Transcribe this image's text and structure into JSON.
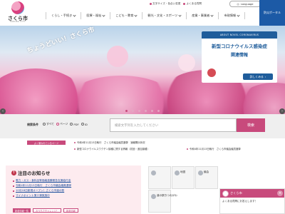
{
  "logo": {
    "text": "さくら市",
    "sub": "SAKURA CITY"
  },
  "util": {
    "links": [
      {
        "label": "文字サイズ・色合い変更"
      },
      {
        "label": "よくある質問"
      }
    ],
    "language": "Language",
    "disaster_portal": "防災ポータル"
  },
  "gnav": [
    {
      "label": "くらし・手続き"
    },
    {
      "label": "医療・福祉"
    },
    {
      "label": "こども・教育"
    },
    {
      "label": "観光・文化・スポーツ"
    },
    {
      "label": "産業・事業者"
    },
    {
      "label": "市政情報"
    }
  ],
  "hero": {
    "catch": "ちょうどいい！さくら市",
    "covid": {
      "top": "ABOUT NOVEL CORONAVIRUS",
      "title": "新型コロナウイルス感染症",
      "sub": "関連情報",
      "more": "詳しくみる"
    }
  },
  "slider": {
    "dots": 6,
    "active_index": 0
  },
  "search": {
    "label": "検索条件",
    "options": [
      {
        "label": "すべて",
        "checked": false
      },
      {
        "label": "ページ",
        "checked": true
      },
      {
        "label": "PDF",
        "checked": false
      },
      {
        "label": "ID",
        "checked": false
      }
    ],
    "placeholder": "検索文字列を入力してください",
    "button": "検索"
  },
  "ticker": {
    "tag": "よく使われているページ",
    "items": [
      {
        "label": "令和4年11月13日執行　さくら市議会議員選挙　速報開示状況"
      },
      {
        "label": "新型コロナウイルスワクチン接種に関する情報（初回・追加接種）"
      },
      {
        "label": "令和4年11月13日執行　さくら市議会議員選挙"
      }
    ]
  },
  "notice": {
    "title": "注目のお知らせ",
    "items": [
      {
        "label": "電力・ガス・食料品等価格高騰緊急支援給付金"
      },
      {
        "label": "令和4年11月13日執行　さくら市議会議員選挙"
      },
      {
        "label": "10月18日新規オープン！さくら市道の駅"
      },
      {
        "label": "マイナポイント第２弾実施中"
      }
    ],
    "tabs": [
      {
        "label": "新着情報一覧"
      },
      {
        "label": "おうちでチャレンジ！"
      },
      {
        "label": "新着情報"
      }
    ]
  },
  "quick": [
    {
      "label": ""
    },
    {
      "label": "地図"
    },
    {
      "label": "議会"
    },
    {
      "label": "道の駅きつれがわ"
    }
  ],
  "chat": {
    "title": "さくら市",
    "message": "よくある質問にお答えします！"
  },
  "colors": {
    "accent": "#c84a7c",
    "navy": "#1f5d9b",
    "notice_bg": "#fdebef"
  }
}
